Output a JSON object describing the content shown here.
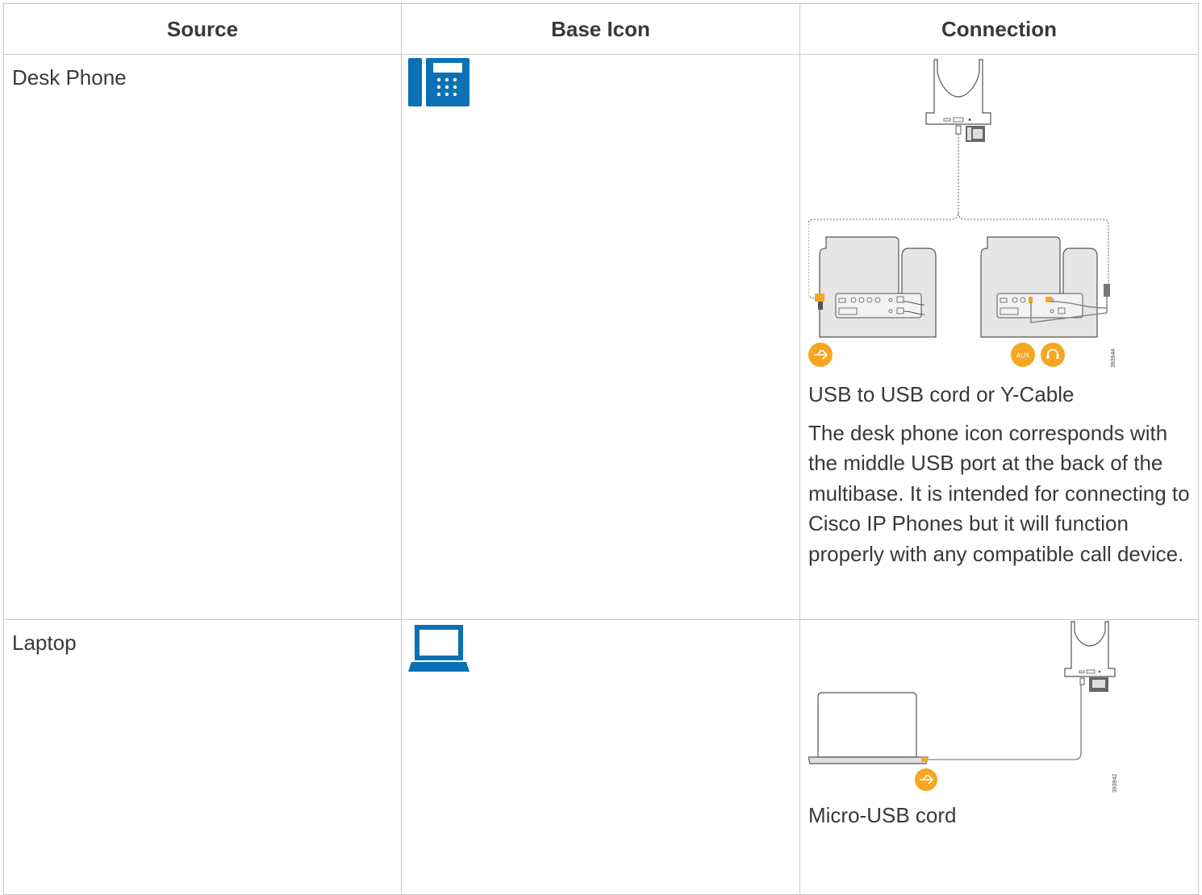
{
  "table": {
    "headers": [
      "Source",
      "Base Icon",
      "Connection"
    ],
    "rows": [
      {
        "source": "Desk Phone",
        "icon": "desk-phone-icon",
        "connection_caption": "USB to USB cord or Y-Cable",
        "connection_description": "The desk phone icon corresponds with the middle USB port at the back of the multibase. It is intended for connecting to Cisco IP Phones but it will function properly with any compatible call device.",
        "diagram": {
          "port_labels": [
            "AUX"
          ],
          "figure_id": "393944"
        }
      },
      {
        "source": "Laptop",
        "icon": "laptop-icon",
        "connection_caption": "Micro-USB cord",
        "diagram": {
          "figure_id": "393942"
        }
      }
    ]
  },
  "colors": {
    "icon_blue": "#0a72b4",
    "port_orange": "#f5a623",
    "border": "#c9c9c9",
    "text": "#39393b"
  }
}
